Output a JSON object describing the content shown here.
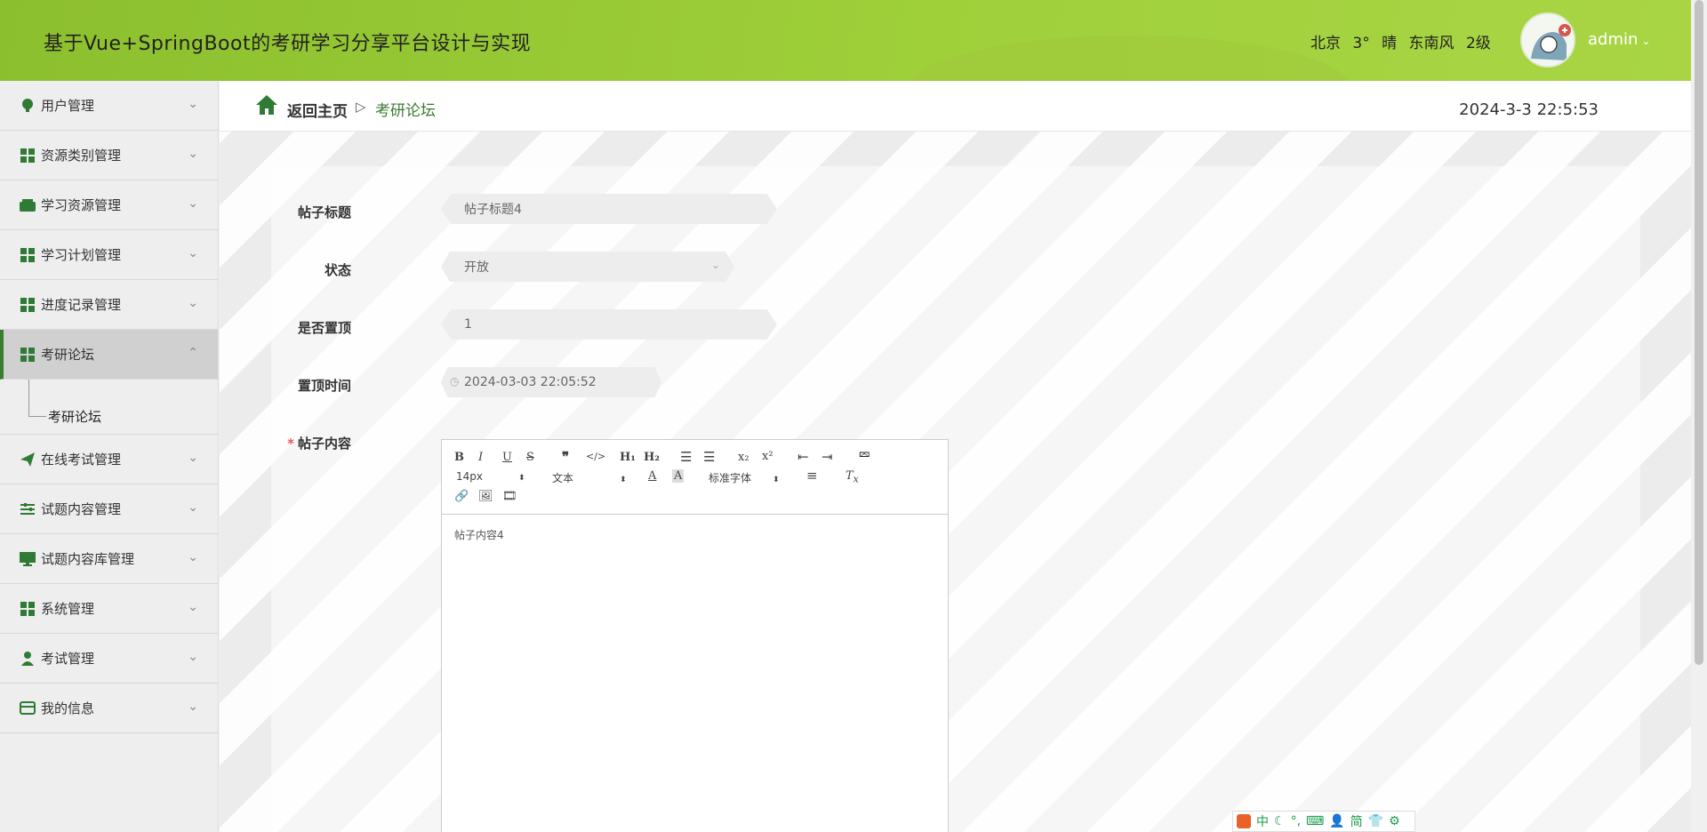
{
  "header": {
    "title": "基于Vue+SpringBoot的考研学习分享平台设计与实现",
    "weather": {
      "city": "北京",
      "temp": "3°",
      "cond": "晴",
      "wind": "东南风",
      "level": "2级"
    },
    "user": "admin"
  },
  "sidebar": {
    "items": [
      {
        "label": "用户管理",
        "icon": "bulb-icon"
      },
      {
        "label": "资源类别管理",
        "icon": "grid-icon"
      },
      {
        "label": "学习资源管理",
        "icon": "wallet-icon"
      },
      {
        "label": "学习计划管理",
        "icon": "grid-icon"
      },
      {
        "label": "进度记录管理",
        "icon": "grid-icon"
      },
      {
        "label": "考研论坛",
        "icon": "grid-icon",
        "active": true
      },
      {
        "label": "在线考试管理",
        "icon": "send-icon"
      },
      {
        "label": "试题内容管理",
        "icon": "sliders-icon"
      },
      {
        "label": "试题内容库管理",
        "icon": "monitor-icon"
      },
      {
        "label": "系统管理",
        "icon": "grid-icon"
      },
      {
        "label": "考试管理",
        "icon": "person-icon"
      },
      {
        "label": "我的信息",
        "icon": "card-icon"
      }
    ],
    "submenu_label": "考研论坛"
  },
  "breadcrumb": {
    "home": "返回主页",
    "sep": "▷",
    "current": "考研论坛"
  },
  "clock": "2024-3-3 22:5:53",
  "form": {
    "title_label": "帖子标题",
    "title_value": "帖子标题4",
    "status_label": "状态",
    "status_value": "开放",
    "top_label": "是否置顶",
    "top_value": "1",
    "top_time_label": "置顶时间",
    "top_time_value": "2024-03-03 22:05:52",
    "content_label": "帖子内容",
    "content_value": "帖子内容4"
  },
  "editor": {
    "font_size": "14px",
    "block": "文本",
    "font_family": "标准字体"
  },
  "ime": {
    "lang": "中",
    "mode": "简"
  },
  "colors": {
    "header": "#9fd03a",
    "accent": "#3a7d31"
  }
}
